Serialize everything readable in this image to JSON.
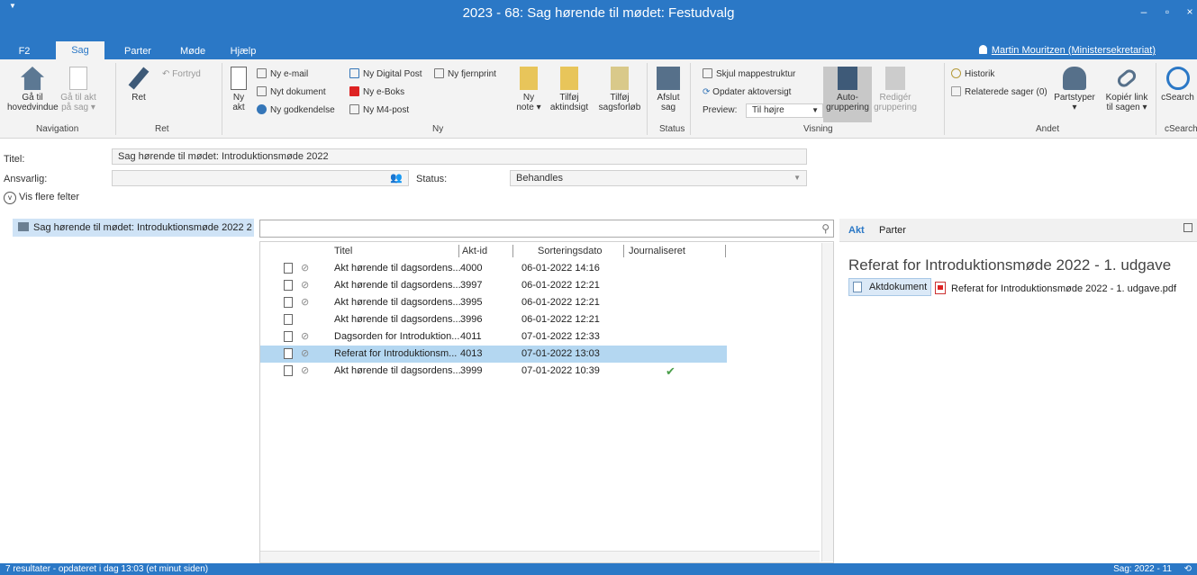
{
  "window": {
    "title": "2023 - 68: Sag hørende til mødet: Festudvalg",
    "minimize": "–",
    "maximize": "▫",
    "close": "×"
  },
  "tabs": [
    {
      "label": "F2"
    },
    {
      "label": "Sag"
    },
    {
      "label": "Parter"
    },
    {
      "label": "Møde"
    },
    {
      "label": "Hjælp"
    }
  ],
  "user": "Martin Mouritzen (Ministersekretariat)",
  "ribbon": {
    "navigation": {
      "label": "Navigation",
      "goto_main": "Gå til\nhovedvindue",
      "goto_case": "Gå til akt\npå sag ▾"
    },
    "ret": {
      "label": "Ret",
      "edit": "Ret",
      "undo": "Fortryd"
    },
    "ny": {
      "label": "Ny",
      "new_act": "Ny\nakt",
      "email": "Ny e-mail",
      "doc": "Nyt dokument",
      "approval": "Ny godkendelse",
      "digital_post": "Ny Digital Post",
      "eboks": "Ny e-Boks",
      "m4": "Ny M4-post",
      "remote_print": "Ny fjernprint",
      "note": "Ny\nnote ▾",
      "add_insight": "Tilføj\naktindsigt",
      "add_flow": "Tilføj\nsagsforløb"
    },
    "status": {
      "label": "Status",
      "close_case": "Afslut\nsag"
    },
    "visning": {
      "label": "Visning",
      "hide_folders": "Skjul mappestruktur",
      "update": "Opdater aktoversigt",
      "preview_label": "Preview:",
      "preview_value": "Til højre",
      "auto_group": "Auto-\ngruppering",
      "edit_group": "Redigér\ngruppering"
    },
    "andet": {
      "label": "Andet",
      "history": "Historik",
      "related": "Relaterede sager (0)",
      "parties": "Partstyper\n▾",
      "copy_link": "Kopiér link\ntil sagen ▾"
    },
    "csearch": {
      "label": "cSearch",
      "btn": "cSearch"
    }
  },
  "form": {
    "title_label": "Titel:",
    "title_value": "Sag hørende til mødet: Introduktionsmøde 2022",
    "resp_label": "Ansvarlig:",
    "resp_value": "",
    "status_label": "Status:",
    "status_value": "Behandles",
    "more_fields": "Vis flere felter"
  },
  "tree": {
    "item": "Sag hørende til mødet: Introduktionsmøde 2022 2"
  },
  "search": {
    "placeholder": ""
  },
  "grid": {
    "headers": {
      "title": "Titel",
      "id": "Akt-id",
      "date": "Sorteringsdato",
      "journal": "Journaliseret"
    },
    "rows": [
      {
        "title": "Akt hørende til dagsordens...",
        "id": "4000",
        "date": "06-01-2022 14:16"
      },
      {
        "title": "Akt hørende til dagsordens...",
        "id": "3997",
        "date": "06-01-2022 12:21"
      },
      {
        "title": "Akt hørende til dagsordens...",
        "id": "3995",
        "date": "06-01-2022 12:21"
      },
      {
        "title": "Akt hørende til dagsordens...",
        "id": "3996",
        "date": "06-01-2022 12:21"
      },
      {
        "title": "Dagsorden for Introduktion...",
        "id": "4011",
        "date": "07-01-2022 12:33"
      },
      {
        "title": "Referat for Introduktionsm...",
        "id": "4013",
        "date": "07-01-2022 13:03"
      },
      {
        "title": "Akt hørende til dagsordens...",
        "id": "3999",
        "date": "07-01-2022 10:39"
      }
    ],
    "checkmark": "✔"
  },
  "right": {
    "tab_akt": "Akt",
    "tab_parter": "Parter",
    "title": "Referat for Introduktionsmøde 2022 - 1. udgave",
    "aktdoc": "Aktdokument",
    "pdf": "Referat for Introduktionsmøde 2022 - 1. udgave.pdf"
  },
  "statusbar": {
    "left": "7 resultater - opdateret i dag 13:03 (et minut siden)",
    "right": "Sag: 2022 - 11"
  }
}
